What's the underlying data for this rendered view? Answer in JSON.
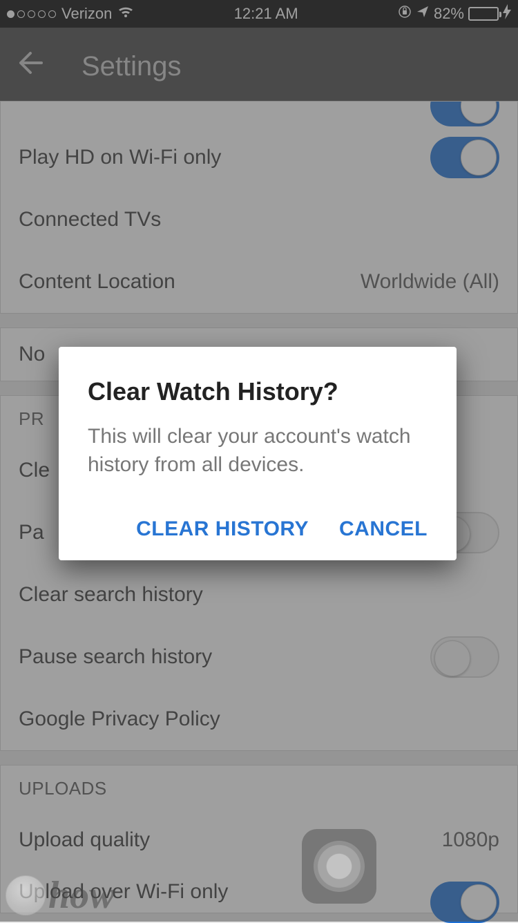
{
  "statusbar": {
    "carrier": "Verizon",
    "time": "12:21 AM",
    "battery_pct": "82%"
  },
  "header": {
    "title": "Settings"
  },
  "sections": {
    "general": {
      "play_hd_wifi": "Play HD on Wi-Fi only",
      "connected_tvs": "Connected TVs",
      "content_location_label": "Content Location",
      "content_location_value": "Worldwide (All)",
      "notifications_partial": "No"
    },
    "privacy": {
      "header": "PR",
      "clear_watch_partial": "Cle",
      "pause_watch_partial": "Pa",
      "clear_search": "Clear search history",
      "pause_search": "Pause search history",
      "google_policy": "Google Privacy Policy"
    },
    "uploads": {
      "header": "UPLOADS",
      "upload_quality_label": "Upload quality",
      "upload_quality_value": "1080p",
      "upload_wifi": "Upload over Wi-Fi only"
    }
  },
  "dialog": {
    "title": "Clear Watch History?",
    "message": "This will clear your account's watch history from all devices.",
    "confirm": "CLEAR HISTORY",
    "cancel": "CANCEL"
  },
  "watermark": "how"
}
